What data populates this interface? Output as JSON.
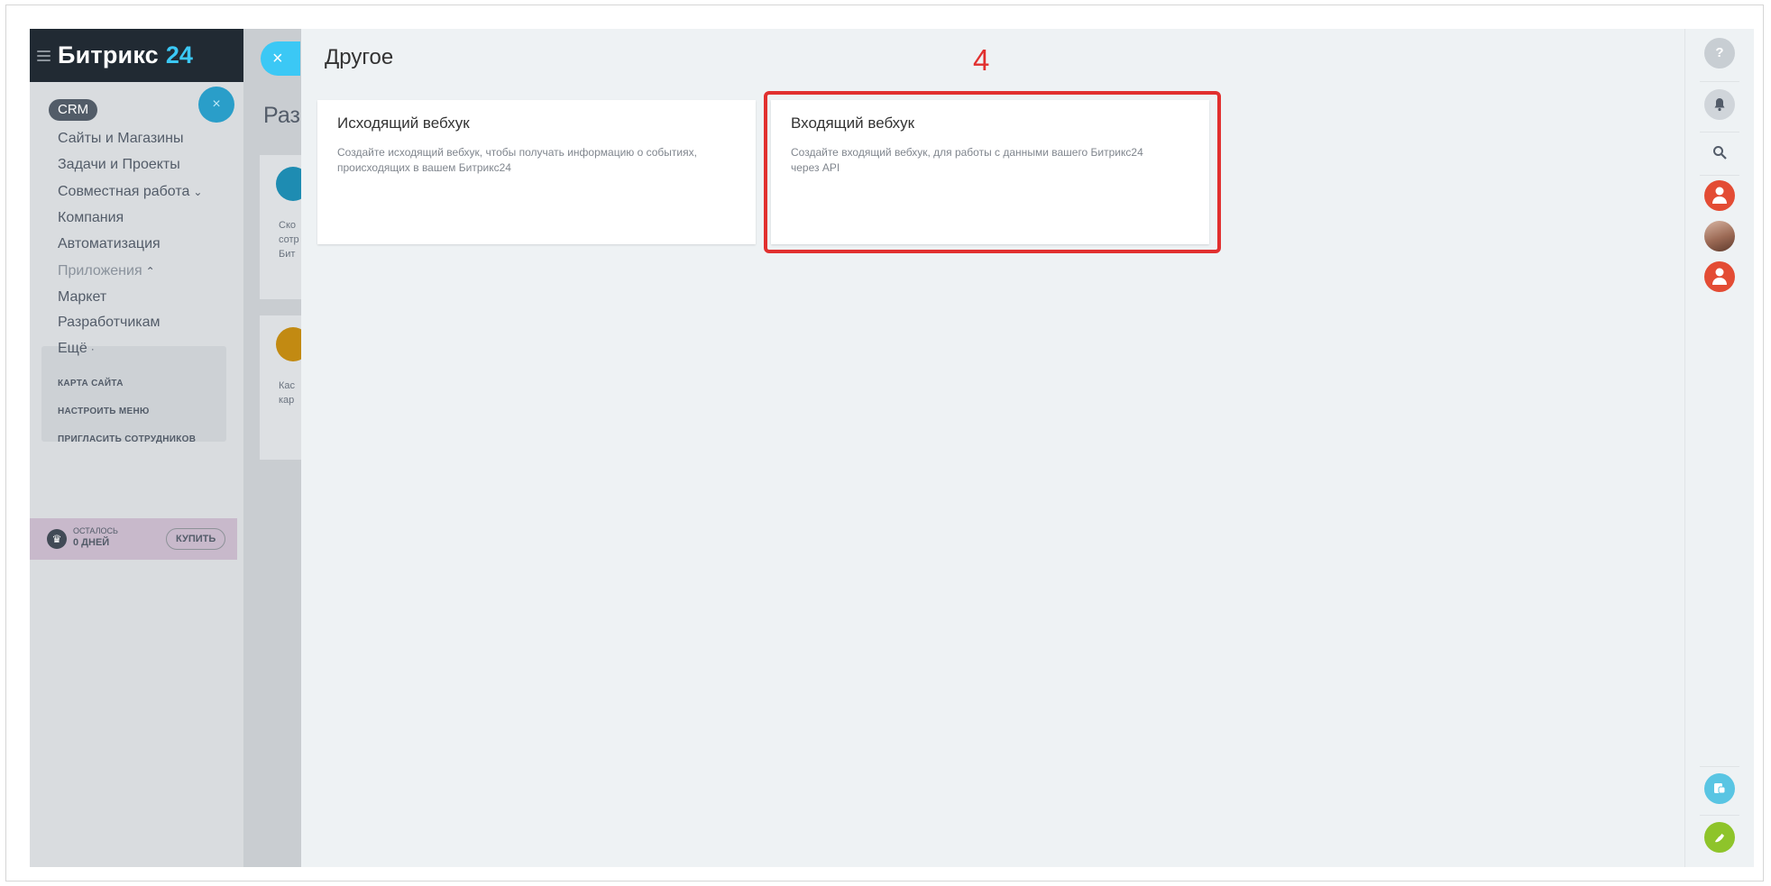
{
  "logo": {
    "text": "Битрикс",
    "number": "24"
  },
  "leftmenu": {
    "crm": "CRM",
    "items": [
      {
        "label": "Сайты и Магазины"
      },
      {
        "label": "Задачи и Проекты"
      },
      {
        "label": "Совместная работа",
        "chevron": "⌄"
      },
      {
        "label": "Компания"
      },
      {
        "label": "Автоматизация"
      },
      {
        "label": "Приложения",
        "chevron": "⌃"
      },
      {
        "label": "Маркет"
      },
      {
        "label": "Разработчикам"
      },
      {
        "label": "Ещё",
        "chevron": "·"
      }
    ],
    "links": [
      "КАРТА САЙТА",
      "НАСТРОИТЬ МЕНЮ",
      "ПРИГЛАСИТЬ СОТРУДНИКОВ"
    ],
    "trial": {
      "small": "ОСТАЛОСЬ",
      "big": "0 ДНЕЙ",
      "buy": "КУПИТЬ"
    }
  },
  "under": {
    "title": "Раз",
    "card1_text": [
      "Ско",
      "сотр",
      "Бит"
    ],
    "card2_text": [
      "Кас",
      "кар"
    ]
  },
  "slider": {
    "close": "×",
    "title": "Другое",
    "step": "4",
    "cards": [
      {
        "title": "Исходящий вебхук",
        "desc_line1": "Создайте исходящий вебхук, чтобы получать информацию о событиях,",
        "desc_line2": "происходящих в вашем Битрикс24"
      },
      {
        "title": "Входящий вебхук",
        "desc_line1": "Создайте входящий вебхук, для работы с данными вашего Битрикс24",
        "desc_line2": "через API"
      }
    ]
  },
  "rightbar": {
    "help": "?",
    "bell": "🔔",
    "search": "⚲"
  },
  "colors": {
    "accent": "#3bc8f5",
    "highlight": "#e1302f",
    "avatar": "#e34c34",
    "phone": "#8ec42a",
    "chat": "#59c5e3"
  }
}
